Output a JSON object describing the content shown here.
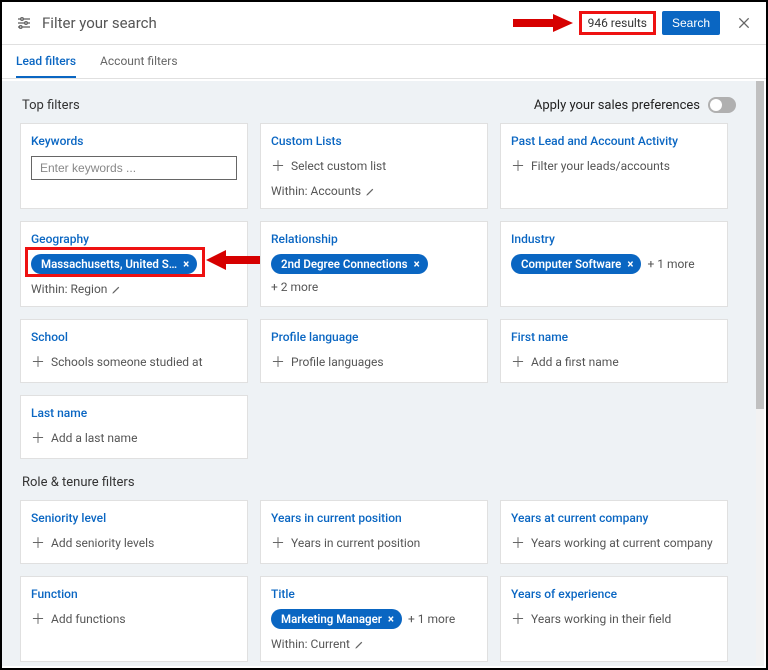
{
  "header": {
    "title": "Filter your search",
    "results_label": "946 results",
    "search_button": "Search"
  },
  "tabs": {
    "lead": "Lead filters",
    "account": "Account filters"
  },
  "sections": {
    "top": "Top filters",
    "role": "Role & tenure filters",
    "preferences": "Apply your sales preferences"
  },
  "cards": {
    "keywords": {
      "title": "Keywords",
      "placeholder": "Enter keywords ..."
    },
    "custom": {
      "title": "Custom Lists",
      "add": "Select custom list",
      "within": "Within: Accounts"
    },
    "past": {
      "title": "Past Lead and Account Activity",
      "add": "Filter your leads/accounts"
    },
    "geo": {
      "title": "Geography",
      "pill": "Massachusetts, United S…",
      "within": "Within: Region"
    },
    "rel": {
      "title": "Relationship",
      "pill": "2nd Degree Connections",
      "more": "+ 2 more"
    },
    "industry": {
      "title": "Industry",
      "pill": "Computer Software",
      "more": "+ 1 more"
    },
    "school": {
      "title": "School",
      "add": "Schools someone studied at"
    },
    "plang": {
      "title": "Profile language",
      "add": "Profile languages"
    },
    "fname": {
      "title": "First name",
      "add": "Add a first name"
    },
    "lname": {
      "title": "Last name",
      "add": "Add a last name"
    },
    "seniority": {
      "title": "Seniority level",
      "add": "Add seniority levels"
    },
    "yearspos": {
      "title": "Years in current position",
      "add": "Years in current position"
    },
    "yearsco": {
      "title": "Years at current company",
      "add": "Years working at current company"
    },
    "function": {
      "title": "Function",
      "add": "Add functions"
    },
    "titlecard": {
      "title": "Title",
      "pill": "Marketing Manager",
      "more": "+ 1 more",
      "within": "Within: Current"
    },
    "yoe": {
      "title": "Years of experience",
      "add": "Years working in their field"
    }
  }
}
